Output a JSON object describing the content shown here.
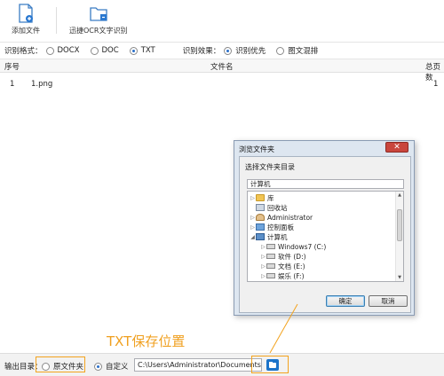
{
  "toolbar": {
    "add_file_label": "添加文件",
    "ocr_label": "迅捷OCR文字识别"
  },
  "options": {
    "format_label": "识别格式：",
    "formats": [
      {
        "label": "DOCX",
        "selected": false
      },
      {
        "label": "DOC",
        "selected": false
      },
      {
        "label": "TXT",
        "selected": true
      }
    ],
    "effect_label": "识别效果：",
    "effects": [
      {
        "label": "识别优先",
        "selected": true
      },
      {
        "label": "图文混排",
        "selected": false
      }
    ]
  },
  "table": {
    "headers": {
      "index": "序号",
      "filename": "文件名",
      "pages": "总页数"
    },
    "rows": [
      {
        "index": "1",
        "filename": "1.png",
        "pages": "1"
      }
    ]
  },
  "dialog": {
    "title": "浏览文件夹",
    "close_symbol": "✕",
    "prompt": "选择文件夹目录",
    "current_path": "计算机",
    "tree": [
      {
        "label": "库",
        "icon": "library-icon",
        "expanded": false
      },
      {
        "label": "回收站",
        "icon": "recycle-bin-icon",
        "expanded": false
      },
      {
        "label": "Administrator",
        "icon": "user-folder-icon",
        "expanded": false
      },
      {
        "label": "控制面板",
        "icon": "control-panel-icon",
        "expanded": false
      },
      {
        "label": "计算机",
        "icon": "computer-icon",
        "expanded": true
      },
      {
        "label": "Windows7 (C:)",
        "icon": "drive-icon",
        "expanded": false
      },
      {
        "label": "软件 (D:)",
        "icon": "drive-icon",
        "expanded": false
      },
      {
        "label": "文档 (E:)",
        "icon": "drive-icon",
        "expanded": false
      },
      {
        "label": "娱乐 (F:)",
        "icon": "drive-icon",
        "expanded": false
      }
    ],
    "ok_label": "确定",
    "cancel_label": "取消"
  },
  "annotation": {
    "text": "TXT保存位置",
    "color": "#f0a020"
  },
  "footer": {
    "output_label": "输出目录：",
    "original_folder_label": "原文件夹",
    "original_selected": false,
    "custom_label": "自定义",
    "custom_selected": true,
    "path_value": "C:\\Users\\Administrator\\Documents"
  }
}
